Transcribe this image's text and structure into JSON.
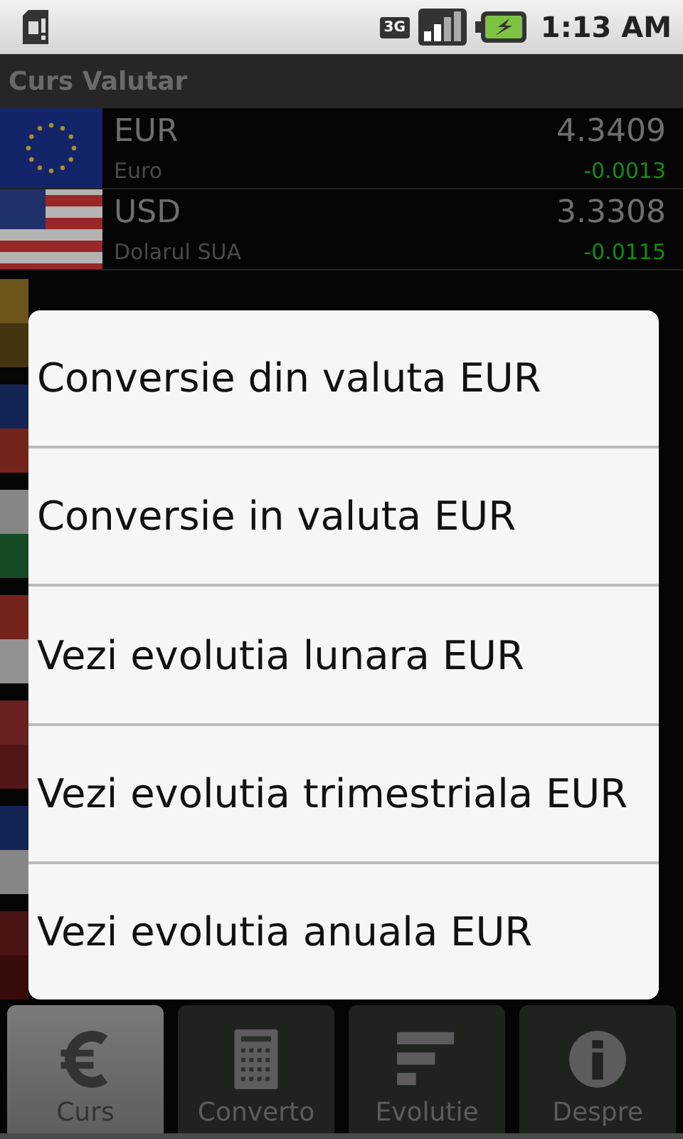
{
  "status_bar": {
    "time": "1:13 AM",
    "network": "3G"
  },
  "title": "Curs Valutar",
  "rates": [
    {
      "code": "EUR",
      "name": "Euro",
      "rate": "4.3409",
      "change": "-0.0013",
      "color": "#138c13"
    },
    {
      "code": "USD",
      "name": "Dolarul SUA",
      "rate": "3.3308",
      "change": "-0.0115",
      "color": "#138c13"
    }
  ],
  "context_menu": {
    "items": [
      "Conversie din valuta EUR",
      "Conversie in valuta EUR",
      "Vezi evolutia lunara EUR",
      "Vezi evolutia trimestriala EUR",
      "Vezi evolutia anuala EUR"
    ]
  },
  "tabs": [
    {
      "label": "Curs",
      "selected": true
    },
    {
      "label": "Converto",
      "selected": false
    },
    {
      "label": "Evolutie",
      "selected": false
    },
    {
      "label": "Despre",
      "selected": false
    }
  ]
}
